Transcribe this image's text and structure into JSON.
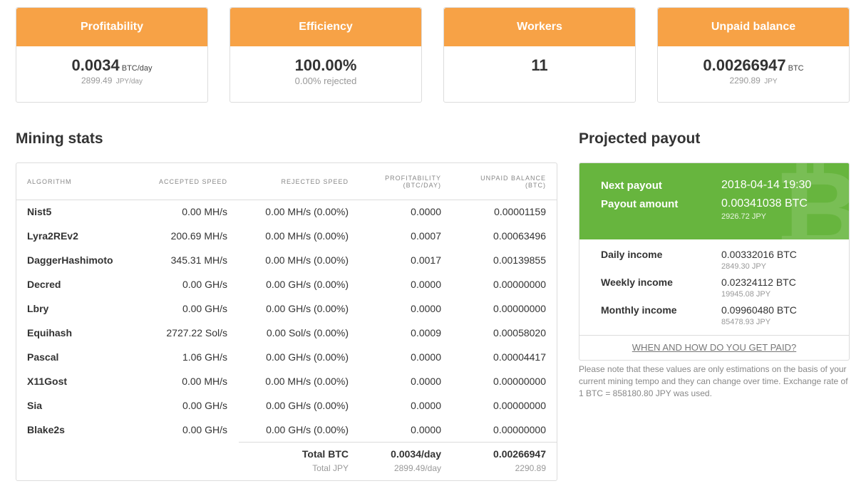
{
  "cards": {
    "profitability": {
      "title": "Profitability",
      "value": "0.0034",
      "unit": "BTC/day",
      "sub_value": "2899.49",
      "sub_unit": "JPY/day"
    },
    "efficiency": {
      "title": "Efficiency",
      "value": "100.00%",
      "sub_value": "0.00% rejected"
    },
    "workers": {
      "title": "Workers",
      "value": "11"
    },
    "unpaid": {
      "title": "Unpaid balance",
      "value": "0.00266947",
      "unit": "BTC",
      "sub_value": "2290.89",
      "sub_unit": "JPY"
    }
  },
  "mining_stats": {
    "title": "Mining stats",
    "columns": {
      "algorithm": "ALGORITHM",
      "accepted": "ACCEPTED SPEED",
      "rejected": "REJECTED SPEED",
      "profitability_line1": "PROFITABILITY",
      "profitability_line2": "(BTC/DAY)",
      "balance_line1": "UNPAID BALANCE",
      "balance_line2": "(BTC)"
    },
    "rows": [
      {
        "algo": "Nist5",
        "accepted": "0.00 MH/s",
        "rejected": "0.00 MH/s (0.00%)",
        "profit": "0.0000",
        "balance": "0.00001159"
      },
      {
        "algo": "Lyra2REv2",
        "accepted": "200.69 MH/s",
        "rejected": "0.00 MH/s (0.00%)",
        "profit": "0.0007",
        "balance": "0.00063496"
      },
      {
        "algo": "DaggerHashimoto",
        "accepted": "345.31 MH/s",
        "rejected": "0.00 MH/s (0.00%)",
        "profit": "0.0017",
        "balance": "0.00139855"
      },
      {
        "algo": "Decred",
        "accepted": "0.00 GH/s",
        "rejected": "0.00 GH/s (0.00%)",
        "profit": "0.0000",
        "balance": "0.00000000"
      },
      {
        "algo": "Lbry",
        "accepted": "0.00 GH/s",
        "rejected": "0.00 GH/s (0.00%)",
        "profit": "0.0000",
        "balance": "0.00000000"
      },
      {
        "algo": "Equihash",
        "accepted": "2727.22 Sol/s",
        "rejected": "0.00 Sol/s (0.00%)",
        "profit": "0.0009",
        "balance": "0.00058020"
      },
      {
        "algo": "Pascal",
        "accepted": "1.06 GH/s",
        "rejected": "0.00 GH/s (0.00%)",
        "profit": "0.0000",
        "balance": "0.00004417"
      },
      {
        "algo": "X11Gost",
        "accepted": "0.00 MH/s",
        "rejected": "0.00 MH/s (0.00%)",
        "profit": "0.0000",
        "balance": "0.00000000"
      },
      {
        "algo": "Sia",
        "accepted": "0.00 GH/s",
        "rejected": "0.00 GH/s (0.00%)",
        "profit": "0.0000",
        "balance": "0.00000000"
      },
      {
        "algo": "Blake2s",
        "accepted": "0.00 GH/s",
        "rejected": "0.00 GH/s (0.00%)",
        "profit": "0.0000",
        "balance": "0.00000000"
      }
    ],
    "totals": {
      "btc_label": "Total BTC",
      "btc_profit": "0.0034/day",
      "btc_balance": "0.00266947",
      "jpy_label": "Total JPY",
      "jpy_profit": "2899.49/day",
      "jpy_balance": "2290.89"
    }
  },
  "payout": {
    "title": "Projected payout",
    "next_label": "Next payout",
    "next_value": "2018-04-14 19:30",
    "amount_label": "Payout amount",
    "amount_value": "0.00341038 BTC",
    "amount_sub": "2926.72 JPY",
    "watermark": "₿",
    "income": [
      {
        "label": "Daily income",
        "btc": "0.00332016 BTC",
        "jpy": "2849.30 JPY"
      },
      {
        "label": "Weekly income",
        "btc": "0.02324112 BTC",
        "jpy": "19945.08 JPY"
      },
      {
        "label": "Monthly income",
        "btc": "0.09960480 BTC",
        "jpy": "85478.93 JPY"
      }
    ],
    "link": "WHEN AND HOW DO YOU GET PAID?",
    "note": "Please note that these values are only estimations on the basis of your current mining tempo and they can change over time. Exchange rate of 1 BTC = 858180.80 JPY was used."
  },
  "colors": {
    "accent_orange": "#f7a246",
    "payout_green": "#67b53e"
  }
}
